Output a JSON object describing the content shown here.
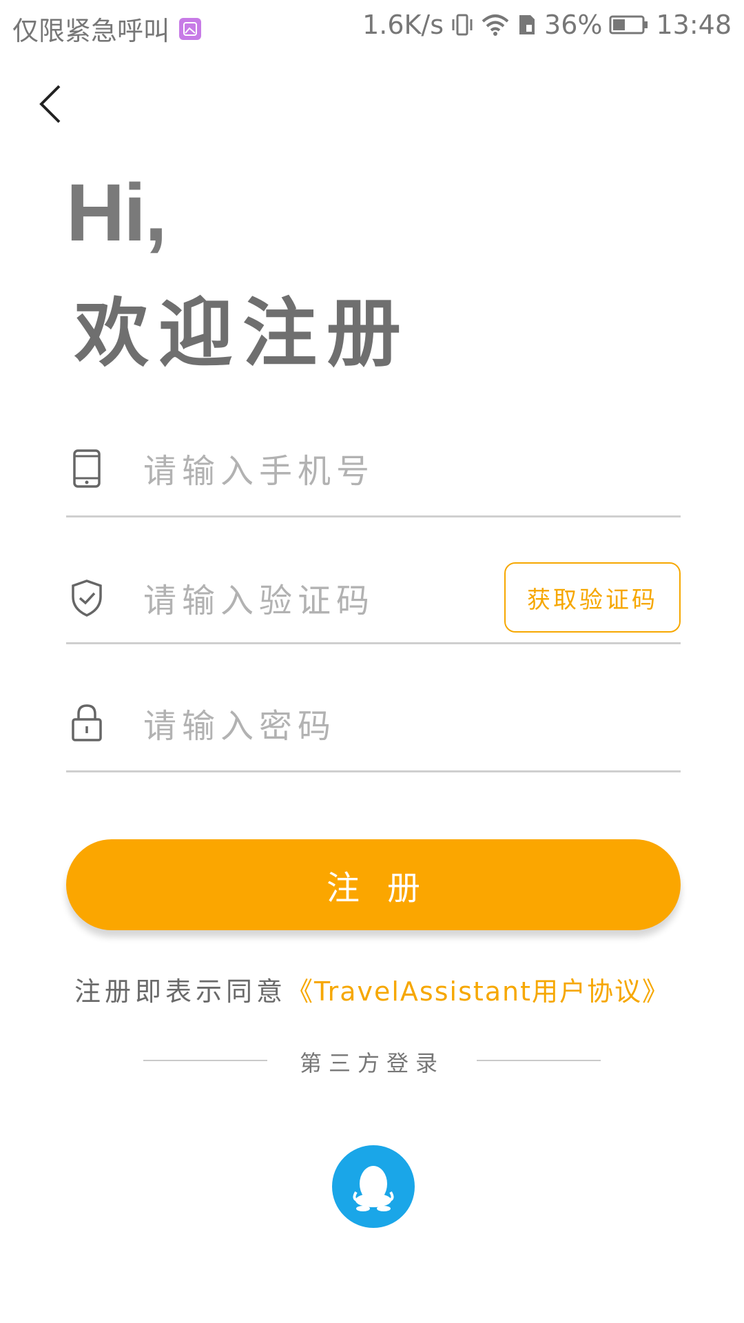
{
  "status_bar": {
    "carrier": "仅限紧急呼叫",
    "speed": "1.6K/s",
    "battery": "36%",
    "time": "13:48"
  },
  "title": {
    "hi": "Hi,",
    "welcome": "欢迎注册"
  },
  "form": {
    "phone_placeholder": "请输入手机号",
    "code_placeholder": "请输入验证码",
    "get_code_label": "获取验证码",
    "password_placeholder": "请输入密码"
  },
  "register_label": "注册",
  "agreement": {
    "prefix": "注册即表示同意",
    "link": "《TravelAssistant用户协议》"
  },
  "third_party_label": "第三方登录",
  "colors": {
    "accent": "#fba600",
    "qq": "#1aa6e8"
  }
}
